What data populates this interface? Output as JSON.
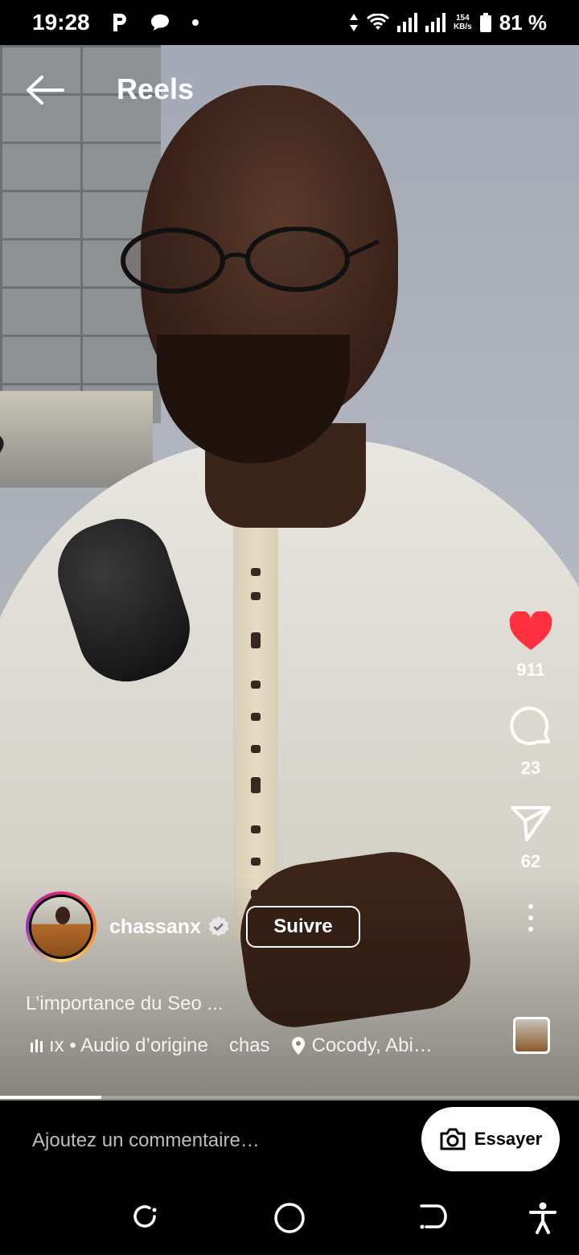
{
  "status_bar": {
    "time": "19:28",
    "notif_icons": [
      "parking-icon",
      "chat-bubble-icon",
      "dot-icon"
    ],
    "net_speed_value": "154",
    "net_speed_unit": "KB/s",
    "battery": "81 %"
  },
  "header": {
    "title": "Reels"
  },
  "actions": {
    "likes": "911",
    "comments": "23",
    "shares": "62",
    "like_color": "#ff3040"
  },
  "author": {
    "username": "chassanx",
    "follow_label": "Suivre"
  },
  "caption": "L’importance du Seo ...",
  "meta": {
    "audio_text": "ıx • Audio d’origine",
    "second_audio": "chas",
    "location": "Cocody, Abi…"
  },
  "progress": {
    "fraction": 0.175
  },
  "comment_bar": {
    "placeholder": "Ajoutez un commentaire…",
    "try_label": "Essayer"
  },
  "nav_icons": [
    "recents-icon",
    "home-icon",
    "back-nav-icon",
    "accessibility-icon"
  ]
}
